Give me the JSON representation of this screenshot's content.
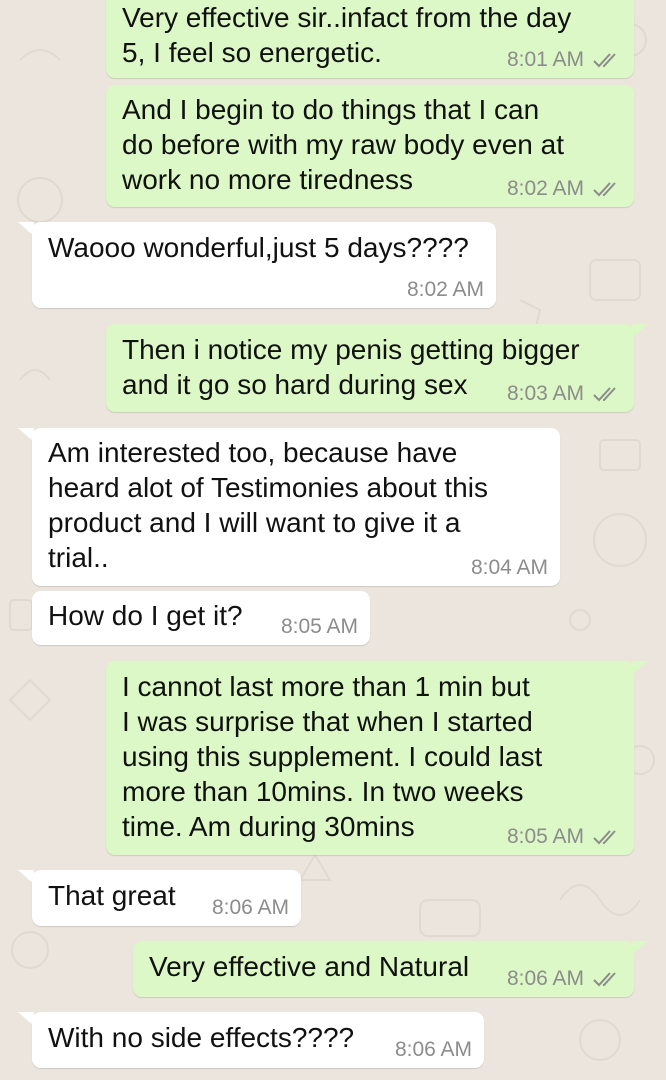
{
  "messages": [
    {
      "direction": "out",
      "text": "Very effective sir..infact from the day\n5, I feel so energetic.",
      "time": "8:01 AM",
      "status": "read-ticks-icon"
    },
    {
      "direction": "out",
      "text": "And I begin to do things that I can\ndo before with my raw body even at\nwork no more tiredness",
      "time": "8:02 AM",
      "status": "read-ticks-icon"
    },
    {
      "direction": "in",
      "text": "Waooo wonderful,just 5 days????",
      "time": "8:02 AM"
    },
    {
      "direction": "out",
      "text": "Then i notice my penis getting bigger\nand it go so hard during sex",
      "time": "8:03 AM",
      "status": "read-ticks-icon"
    },
    {
      "direction": "in",
      "text": "Am interested too, because have\nheard alot of Testimonies about this\nproduct and I will want to give it a\ntrial..",
      "time": "8:04 AM"
    },
    {
      "direction": "in",
      "text": "How do I get it?",
      "time": "8:05 AM"
    },
    {
      "direction": "out",
      "text": "I cannot last more than 1 min but\nI was surprise that when I started\nusing this supplement. I could last\nmore than 10mins. In two weeks\ntime. Am during 30mins",
      "time": "8:05 AM",
      "status": "read-ticks-icon"
    },
    {
      "direction": "in",
      "text": "That great",
      "time": "8:06 AM"
    },
    {
      "direction": "out",
      "text": "Very effective and Natural",
      "time": "8:06 AM",
      "status": "read-ticks-icon"
    },
    {
      "direction": "in",
      "text": "With no side effects????",
      "time": "8:06 AM"
    }
  ],
  "colors": {
    "background": "#ece5dd",
    "outgoing_bubble": "#dcf8c6",
    "incoming_bubble": "#ffffff",
    "time_text": "#8c8c8c",
    "ticks": "#8c8c8c"
  }
}
